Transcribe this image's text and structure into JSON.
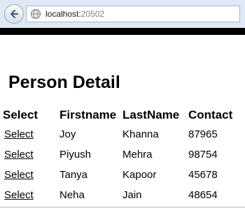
{
  "browser": {
    "url_host": "localhost:",
    "url_port": "20502"
  },
  "page": {
    "title": "Person Detail"
  },
  "table": {
    "headers": {
      "select": "Select",
      "firstname": "Firstname",
      "lastname": "LastName",
      "contact": "Contact"
    },
    "rows": [
      {
        "select": "Select",
        "firstname": "Joy",
        "lastname": "Khanna",
        "contact": "87965"
      },
      {
        "select": "Select",
        "firstname": "Piyush",
        "lastname": "Mehra",
        "contact": "98754"
      },
      {
        "select": "Select",
        "firstname": "Tanya",
        "lastname": "Kapoor",
        "contact": "45678"
      },
      {
        "select": "Select",
        "firstname": "Neha",
        "lastname": "Jain",
        "contact": "48654"
      }
    ]
  }
}
